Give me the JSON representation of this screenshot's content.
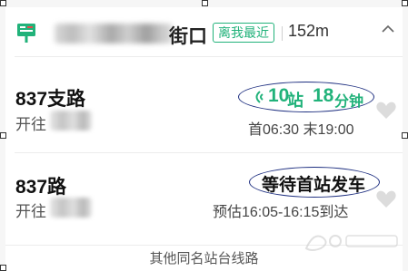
{
  "header": {
    "stop_name_suffix": "街口",
    "nearest_badge": "离我最近",
    "distance": "152m"
  },
  "routes": [
    {
      "name": "837支路",
      "direction_prefix": "开往",
      "realtime": {
        "stops": "10",
        "stops_unit": "站",
        "minutes": "18",
        "minutes_unit": "分钟"
      },
      "schedule": "首06:30 末19:00"
    },
    {
      "name": "837路",
      "direction_prefix": "开往",
      "status": "等待首站发车",
      "schedule": "预估16:05-16:15到达"
    }
  ],
  "footer": {
    "other_routes_link": "其他同名站台线路"
  },
  "colors": {
    "accent_green": "#21b27a",
    "annotation_ring": "#1e2f80"
  },
  "icons": [
    "bus-stop-icon",
    "chevron-up-icon",
    "realtime-signal-icon",
    "heart-icon"
  ]
}
